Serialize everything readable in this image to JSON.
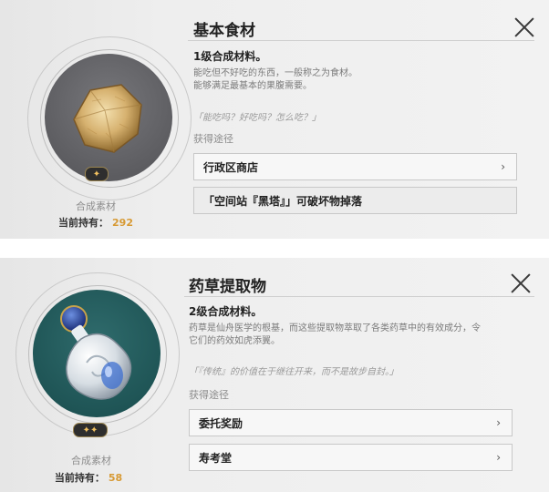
{
  "items": [
    {
      "title": "基本食材",
      "level_text": "1级合成材料。",
      "description": [
        "能吃但不好吃的东西，一般称之为食材。",
        "能够满足最基本的果腹需要。"
      ],
      "quote": "「能吃吗？好吃吗？怎么吃？」",
      "source_label": "获得途径",
      "sources": [
        "行政区商店",
        "「空间站『黑塔』」可破坏物掉落"
      ],
      "category": "合成素材",
      "holding_label": "当前持有：",
      "holding_count": "292",
      "rarity": "✦"
    },
    {
      "title": "药草提取物",
      "level_text": "2级合成材料。",
      "description": [
        "药草是仙舟医学的根基，而这些提取物萃取了各类药草中的有效成分，令",
        "它们的药效如虎添翼。"
      ],
      "quote": "「『传统』的价值在于继往开来，而不是故步自封。」",
      "source_label": "获得途径",
      "sources": [
        "委托奖励",
        "寿考堂"
      ],
      "category": "合成素材",
      "holding_label": "当前持有：",
      "holding_count": "58",
      "rarity": "✦✦"
    }
  ],
  "icons": {
    "close": "close-icon",
    "chevron": "chevron-right-icon",
    "item1": "food-ingredient-icon",
    "item2": "herb-extract-bottle-icon"
  },
  "chevron_glyph": "›",
  "colors": {
    "accent": "#d79a34",
    "disc1": "#5d5d61",
    "disc2": "#1f5556"
  }
}
